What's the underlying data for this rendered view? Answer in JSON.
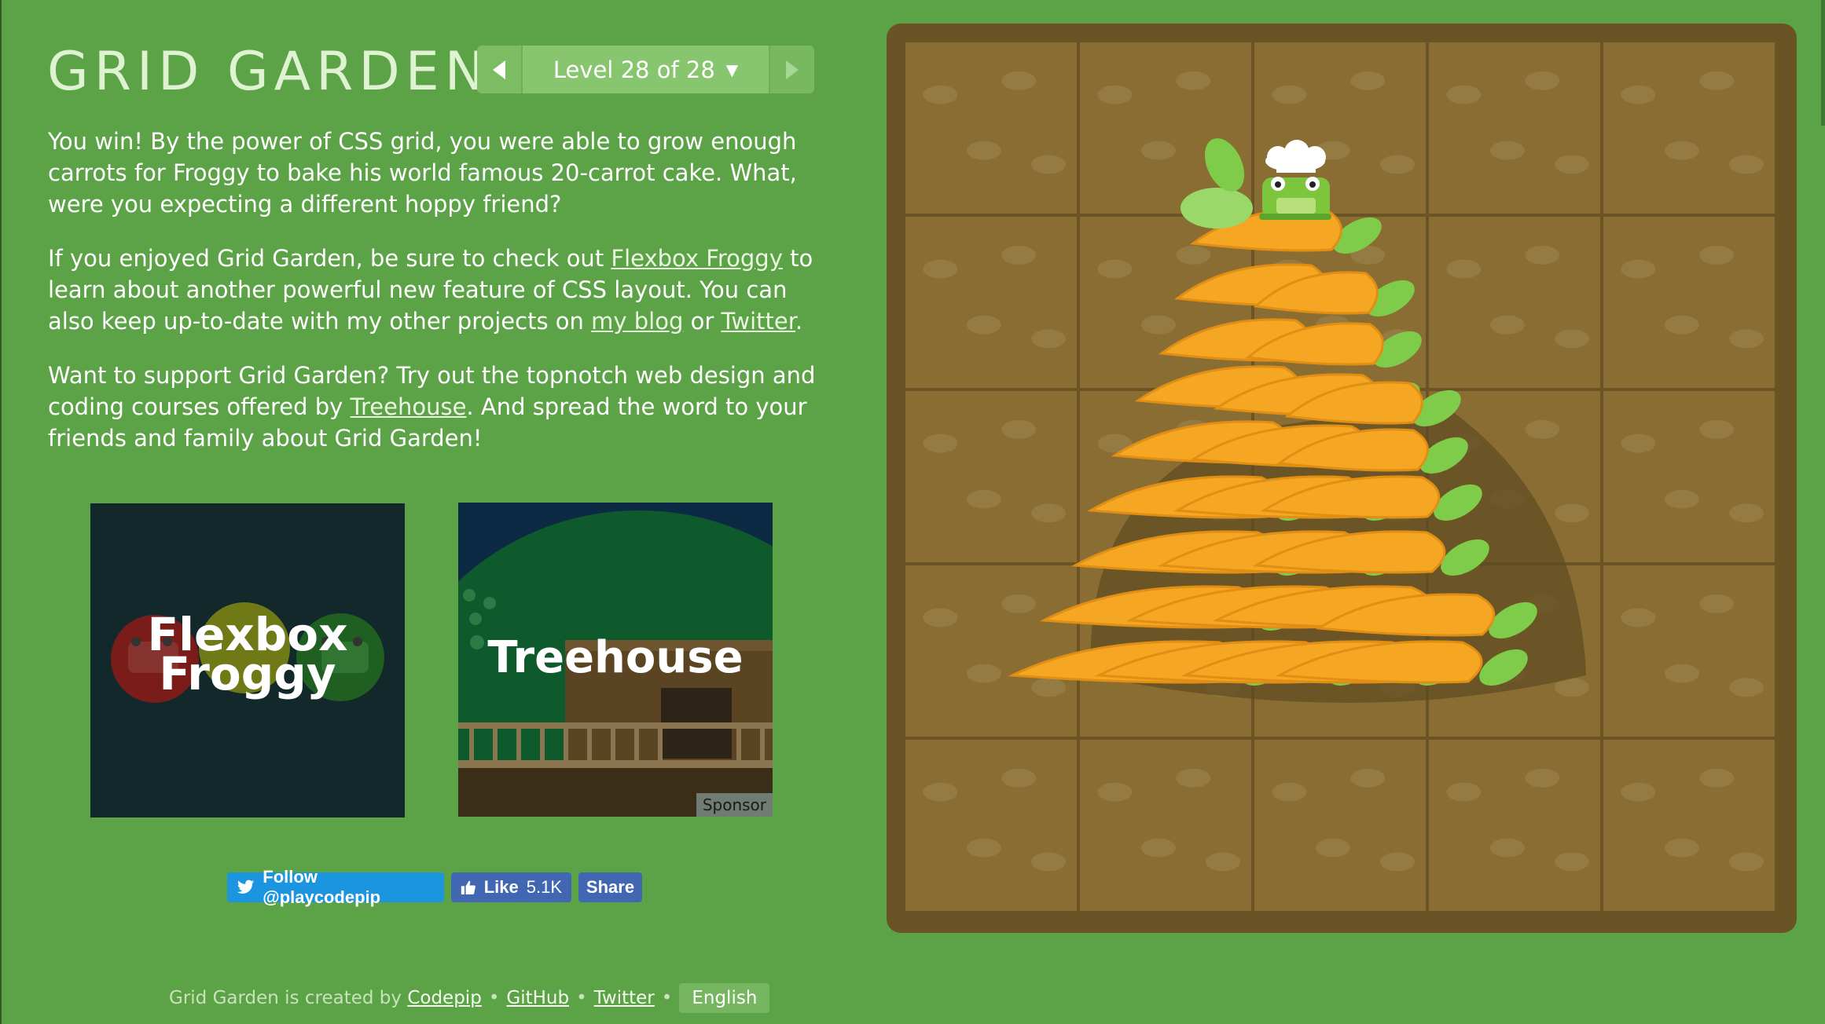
{
  "header": {
    "title": "GRID GARDEN",
    "level_label": "Level 28 of 28",
    "prev_label": "previous level",
    "next_label": "next level"
  },
  "instructions": {
    "p1": "You win! By the power of CSS grid, you were able to grow enough carrots for Froggy to bake his world famous 20-carrot cake. What, were you expecting a different hoppy friend?",
    "p2_before": "If you enjoyed Grid Garden, be sure to check out ",
    "p2_link1": "Flexbox Froggy",
    "p2_mid": " to learn about another powerful new feature of CSS layout. You can also keep up-to-date with my other projects on ",
    "p2_link2": "my blog",
    "p2_or": " or ",
    "p2_link3": "Twitter",
    "p2_end": ".",
    "p3_before": "Want to support Grid Garden? Try out the topnotch web design and coding courses offered by ",
    "p3_link": "Treehouse",
    "p3_after": ". And spread the word to your friends and family about Grid Garden!"
  },
  "promos": {
    "froggy_line1": "Flexbox",
    "froggy_line2": "Froggy",
    "treehouse_title": "Treehouse",
    "sponsor": "Sponsor"
  },
  "social": {
    "twitter_follow": "Follow @playcodepip",
    "fb_like": "Like",
    "fb_like_count": "5.1K",
    "fb_share": "Share"
  },
  "footer": {
    "created_by": "Grid Garden is created by",
    "codepip": "Codepip",
    "github": "GitHub",
    "twitter": "Twitter",
    "language": "English",
    "separator": "•"
  },
  "garden": {
    "rows": 5,
    "columns": 5,
    "soil_color": "#8a6d33",
    "frame_color": "#6a5426",
    "carrot_color": "#f5a623",
    "leaf_color": "#7fcc4a",
    "frog_color": "#7cc53c"
  },
  "icons": {
    "prev": "left-triangle-icon",
    "next": "right-triangle-icon",
    "dropdown": "caret-down-icon",
    "twitter": "twitter-bird-icon",
    "like": "thumbs-up-icon"
  }
}
